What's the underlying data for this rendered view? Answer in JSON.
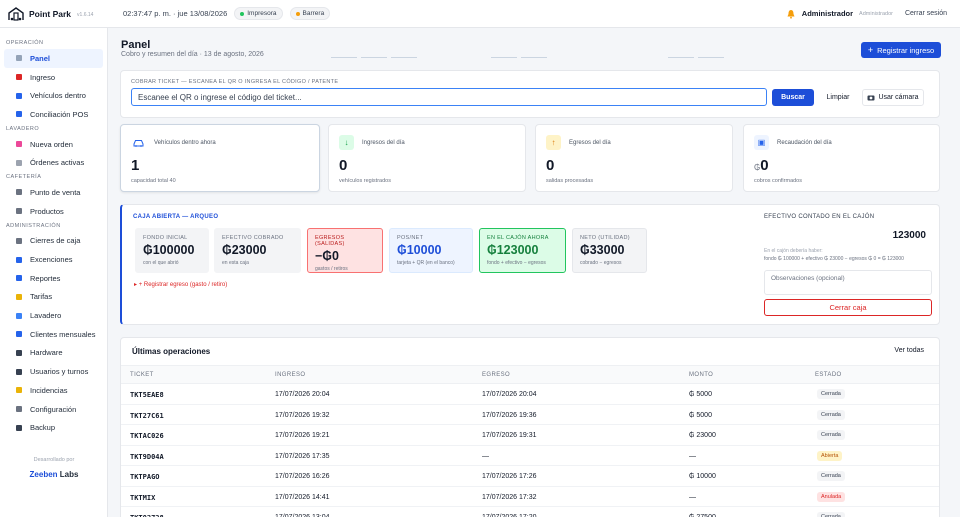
{
  "app": {
    "name": "Point Park",
    "version": "v1.6.14"
  },
  "top": {
    "clock": "02:37:47 p. m. · jue 13/08/2026",
    "printer": "Impresora",
    "barrier": "Barrera",
    "printer_color": "#22c55e",
    "barrier_color": "#f59e0b",
    "user": "Administrador",
    "role": "Administrador",
    "logout": "Cerrar sesión"
  },
  "sidebar": {
    "sections": [
      {
        "title": "OPERACIÓN",
        "items": [
          {
            "label": "Panel",
            "icon": "dashboard-icon",
            "color": "#6b7280",
            "active": true
          },
          {
            "label": "Ingreso",
            "icon": "car-icon",
            "color": "#dc2626"
          },
          {
            "label": "Vehículos dentro",
            "icon": "parking-icon",
            "color": "#2563eb"
          },
          {
            "label": "Conciliación POS",
            "icon": "pos-icon",
            "color": "#2563eb"
          }
        ]
      },
      {
        "title": "LAVADERO",
        "items": [
          {
            "label": "Nueva orden",
            "icon": "wash-icon",
            "color": "#ec4899"
          },
          {
            "label": "Órdenes activas",
            "icon": "clipboard-icon",
            "color": "#9ca3af"
          }
        ]
      },
      {
        "title": "CAFETERÍA",
        "items": [
          {
            "label": "Punto de venta",
            "icon": "coffee-icon",
            "color": "#6b7280"
          },
          {
            "label": "Productos",
            "icon": "box-icon",
            "color": "#6b7280"
          }
        ]
      },
      {
        "title": "ADMINISTRACIÓN",
        "items": [
          {
            "label": "Cierres de caja",
            "icon": "register-icon",
            "color": "#6b7280"
          },
          {
            "label": "Excenciones",
            "icon": "exemption-icon",
            "color": "#2563eb"
          },
          {
            "label": "Reportes",
            "icon": "chart-icon",
            "color": "#2563eb"
          },
          {
            "label": "Tarifas",
            "icon": "tag-icon",
            "color": "#eab308"
          },
          {
            "label": "Lavadero",
            "icon": "water-icon",
            "color": "#3b82f6"
          },
          {
            "label": "Clientes mensuales",
            "icon": "calendar-icon",
            "color": "#2563eb"
          },
          {
            "label": "Hardware",
            "icon": "plug-icon",
            "color": "#374151"
          },
          {
            "label": "Usuarios y turnos",
            "icon": "users-icon",
            "color": "#374151"
          },
          {
            "label": "Incidencias",
            "icon": "warning-icon",
            "color": "#eab308"
          },
          {
            "label": "Configuración",
            "icon": "gear-icon",
            "color": "#6b7280"
          },
          {
            "label": "Backup",
            "icon": "backup-icon",
            "color": "#374151"
          }
        ]
      }
    ],
    "credit": "Desarrollado por",
    "credit_a": "Zeeben",
    "credit_b": "Labs",
    "credit_a_color": "#1d4ed8"
  },
  "page": {
    "title": "Panel",
    "subtitle": "Cobro y resumen del día · 13 de agosto, 2026",
    "register_btn": "Registrar ingreso"
  },
  "scan": {
    "label": "COBRAR TICKET — ESCANEA EL QR O INGRESA EL CÓDIGO / PATENTE",
    "placeholder": "Escanee el QR o ingrese el código del ticket...",
    "search": "Buscar",
    "clear": "Limpiar",
    "camera": "Usar cámara"
  },
  "stats": [
    {
      "label": "Vehículos dentro ahora",
      "value": "1",
      "sub": "capacidad total 40",
      "icon": "car-icon",
      "icon_bg": "#eef4ff",
      "icon_color": "#2563eb"
    },
    {
      "label": "Ingresos del día",
      "value": "0",
      "sub": "vehículos registrados",
      "icon": "arrow-down-icon",
      "icon_bg": "#dcfce7",
      "icon_color": "#16a34a"
    },
    {
      "label": "Egresos del día",
      "value": "0",
      "sub": "salidas procesadas",
      "icon": "arrow-up-icon",
      "icon_bg": "#fef3c7",
      "icon_color": "#d97706"
    },
    {
      "label": "Recaudación del día",
      "value": "0",
      "prefix": "₲",
      "sub": "cobros confirmados",
      "icon": "cash-icon",
      "icon_bg": "#eef4ff",
      "icon_color": "#2563eb"
    }
  ],
  "arqueo": {
    "title": "CAJA ABIERTA — ARQUEO",
    "cards": [
      {
        "label": "FONDO INICIAL",
        "value": "₲100000",
        "sub": "con el que abrió",
        "bg": "#f3f4f6",
        "border": "#f3f4f6",
        "label_color": "#6b7280"
      },
      {
        "label": "EFECTIVO COBRADO",
        "value": "₲23000",
        "sub": "en esta caja",
        "bg": "#f3f4f6",
        "border": "#f3f4f6",
        "label_color": "#6b7280"
      },
      {
        "label": "EGRESOS (SALIDAS)",
        "value": "−₲0",
        "sub": "gastos / retiros",
        "bg": "#fee2e2",
        "border": "#f87171",
        "label_color": "#b91c1c"
      },
      {
        "label": "POS/NET",
        "value": "₲10000",
        "sub": "tarjeta + QR (en el banco)",
        "bg": "#eef4ff",
        "border": "#dbeafe",
        "label_color": "#6b7280",
        "value_color": "#1d4ed8"
      },
      {
        "label": "EN EL CAJÓN AHORA",
        "value": "₲123000",
        "sub": "fondo + efectivo − egresos",
        "bg": "#dcfce7",
        "border": "#22c55e",
        "label_color": "#15803d",
        "value_color": "#15803d"
      },
      {
        "label": "NETO (UTILIDAD)",
        "value": "₲33000",
        "sub": "cobrado − egresos",
        "bg": "#f3f4f6",
        "border": "#e5e7eb",
        "label_color": "#6b7280"
      }
    ],
    "egreso_link": "+ Registrar egreso (gasto / retiro)",
    "efectivo_label": "EFECTIVO CONTADO EN EL CAJÓN",
    "efectivo_value": "123000",
    "efectivo_note": "En el cajón debería haber:",
    "efectivo_calc": "fondo ₲ 100000 + efectivo ₲ 23000 − egresos ₲ 0 = ₲ 123000",
    "obs_placeholder": "Observaciones (opcional)",
    "close_btn": "Cerrar caja"
  },
  "ops": {
    "title": "Últimas operaciones",
    "all": "Ver todas",
    "headers": [
      "TICKET",
      "INGRESO",
      "EGRESO",
      "MONTO",
      "ESTADO"
    ],
    "rows": [
      {
        "ticket": "TKT5EAE8",
        "in": "17/07/2026 20:04",
        "out": "17/07/2026 20:04",
        "amount": "₲ 5000",
        "status": "Cerrada",
        "kind": "closed"
      },
      {
        "ticket": "TKT27C61",
        "in": "17/07/2026 19:32",
        "out": "17/07/2026 19:36",
        "amount": "₲ 5000",
        "status": "Cerrada",
        "kind": "closed"
      },
      {
        "ticket": "TKTAC026",
        "in": "17/07/2026 19:21",
        "out": "17/07/2026 19:31",
        "amount": "₲ 23000",
        "status": "Cerrada",
        "kind": "closed"
      },
      {
        "ticket": "TKT9D04A",
        "in": "17/07/2026 17:35",
        "out": "—",
        "amount": "—",
        "status": "Abierta",
        "kind": "open"
      },
      {
        "ticket": "TKTPAGO",
        "in": "17/07/2026 16:26",
        "out": "17/07/2026 17:26",
        "amount": "₲ 10000",
        "status": "Cerrada",
        "kind": "closed"
      },
      {
        "ticket": "TKTMIX",
        "in": "17/07/2026 14:41",
        "out": "17/07/2026 17:32",
        "amount": "—",
        "status": "Anulada",
        "kind": "void"
      },
      {
        "ticket": "TKT02728",
        "in": "17/07/2026 13:04",
        "out": "17/07/2026 17:20",
        "amount": "₲ 27500",
        "status": "Cerrada",
        "kind": "closed"
      }
    ]
  }
}
